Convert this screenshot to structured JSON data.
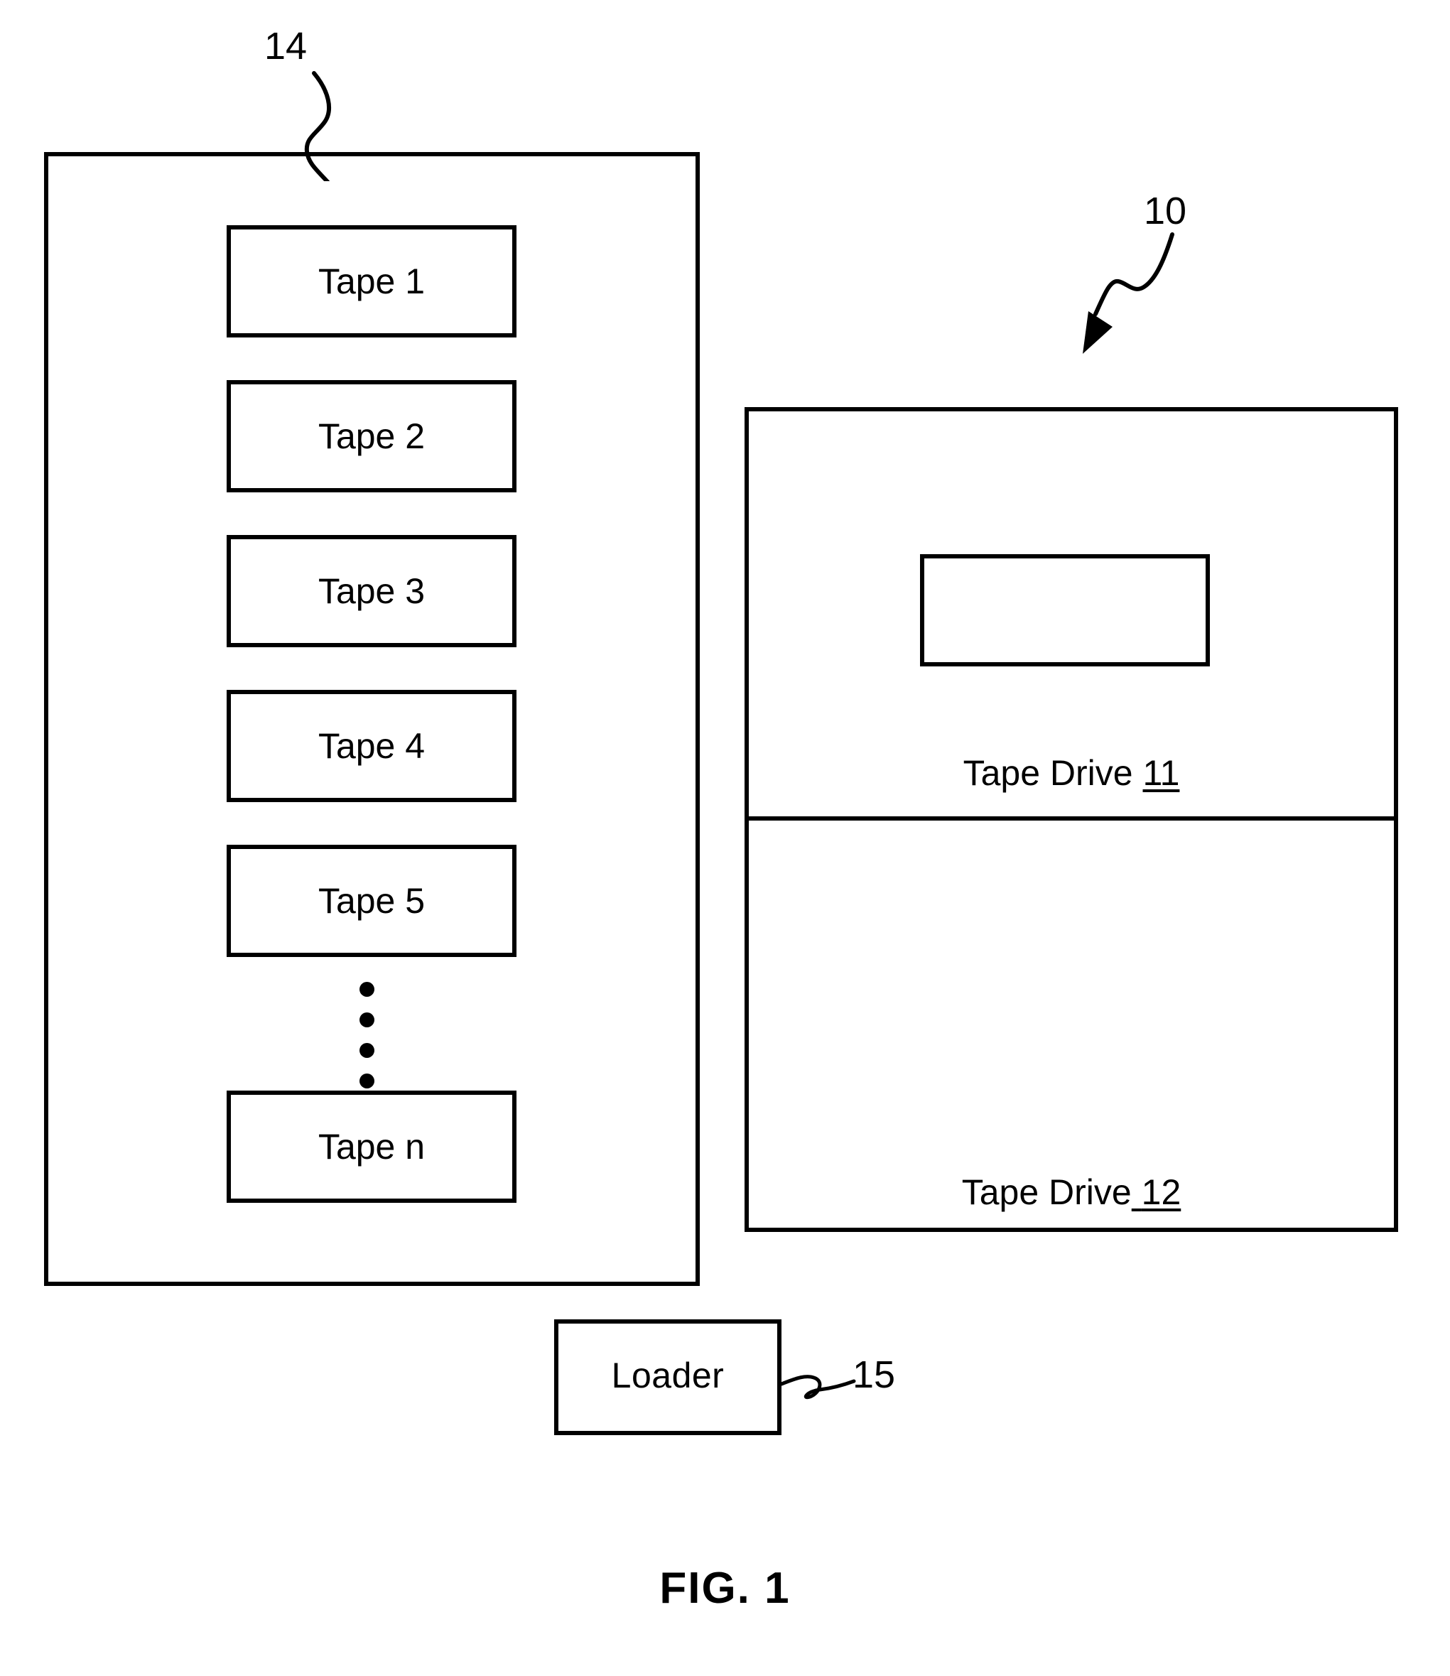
{
  "figure": {
    "caption": "FIG. 1"
  },
  "library": {
    "reference_numeral": "14",
    "tapes": [
      {
        "label": "Tape 1"
      },
      {
        "label": "Tape 2"
      },
      {
        "label": "Tape 3"
      },
      {
        "label": "Tape 4"
      },
      {
        "label": "Tape 5"
      },
      {
        "label": "Tape n"
      }
    ],
    "ellipsis_dot_count": 4
  },
  "drive_unit": {
    "reference_numeral": "10",
    "drives": [
      {
        "name": "Tape Drive",
        "reference_numeral": "11"
      },
      {
        "name": "Tape Drive",
        "reference_numeral": "12"
      }
    ]
  },
  "loader": {
    "label": "Loader",
    "reference_numeral": "15"
  },
  "style": {
    "stroke_color": "#000000",
    "background_color": "#ffffff"
  }
}
